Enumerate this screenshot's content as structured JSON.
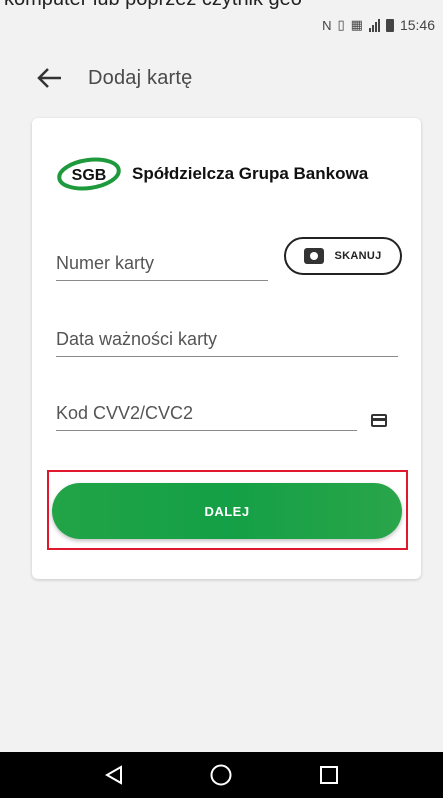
{
  "caption_text": "komputer lub poprzez czytnik geo",
  "status_bar": {
    "time": "15:46"
  },
  "app_bar": {
    "title": "Dodaj kartę"
  },
  "card": {
    "bank_logo_text": "SGB",
    "bank_name": "Spółdzielcza Grupa Bankowa",
    "fields": {
      "card_number_placeholder": "Numer karty",
      "expiry_placeholder": "Data ważności karty",
      "cvv_placeholder": "Kod CVV2/CVC2"
    },
    "scan_button": {
      "label": "SKANUJ"
    },
    "next_button": {
      "label": "DALEJ"
    }
  },
  "colors": {
    "accent_green": "#14a046",
    "highlight_red": "#e0182d",
    "logo_green": "#1e9a3c"
  },
  "icons": {
    "back": "arrow-left-icon",
    "scan": "camera-icon",
    "cvv_info": "credit-card-icon",
    "nav_back": "triangle-back-icon",
    "nav_home": "circle-home-icon",
    "nav_recent": "square-recents-icon"
  }
}
